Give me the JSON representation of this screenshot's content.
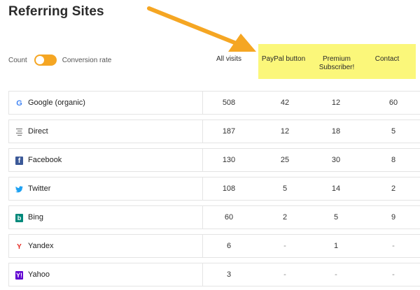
{
  "title": "Referring Sites",
  "toggle": {
    "left_label": "Count",
    "right_label": "Conversion rate",
    "state": "count"
  },
  "columns": {
    "all_visits": "All visits",
    "paypal": "PayPal button",
    "premium_line1": "Premium",
    "premium_line2": "Subscriber!",
    "contact": "Contact"
  },
  "colors": {
    "accent": "#f5a623",
    "highlight": "#fbf77a",
    "arrow": "#f5a623"
  },
  "rows": [
    {
      "icon": "google-icon",
      "site": "Google (organic)",
      "all": "508",
      "paypal": "42",
      "premium": "12",
      "contact": "60"
    },
    {
      "icon": "direct-icon",
      "site": "Direct",
      "all": "187",
      "paypal": "12",
      "premium": "18",
      "contact": "5"
    },
    {
      "icon": "facebook-icon",
      "site": "Facebook",
      "all": "130",
      "paypal": "25",
      "premium": "30",
      "contact": "8"
    },
    {
      "icon": "twitter-icon",
      "site": "Twitter",
      "all": "108",
      "paypal": "5",
      "premium": "14",
      "contact": "2"
    },
    {
      "icon": "bing-icon",
      "site": "Bing",
      "all": "60",
      "paypal": "2",
      "premium": "5",
      "contact": "9"
    },
    {
      "icon": "yandex-icon",
      "site": "Yandex",
      "all": "6",
      "paypal": "-",
      "premium": "1",
      "contact": "-"
    },
    {
      "icon": "yahoo-icon",
      "site": "Yahoo",
      "all": "3",
      "paypal": "-",
      "premium": "-",
      "contact": "-"
    }
  ]
}
